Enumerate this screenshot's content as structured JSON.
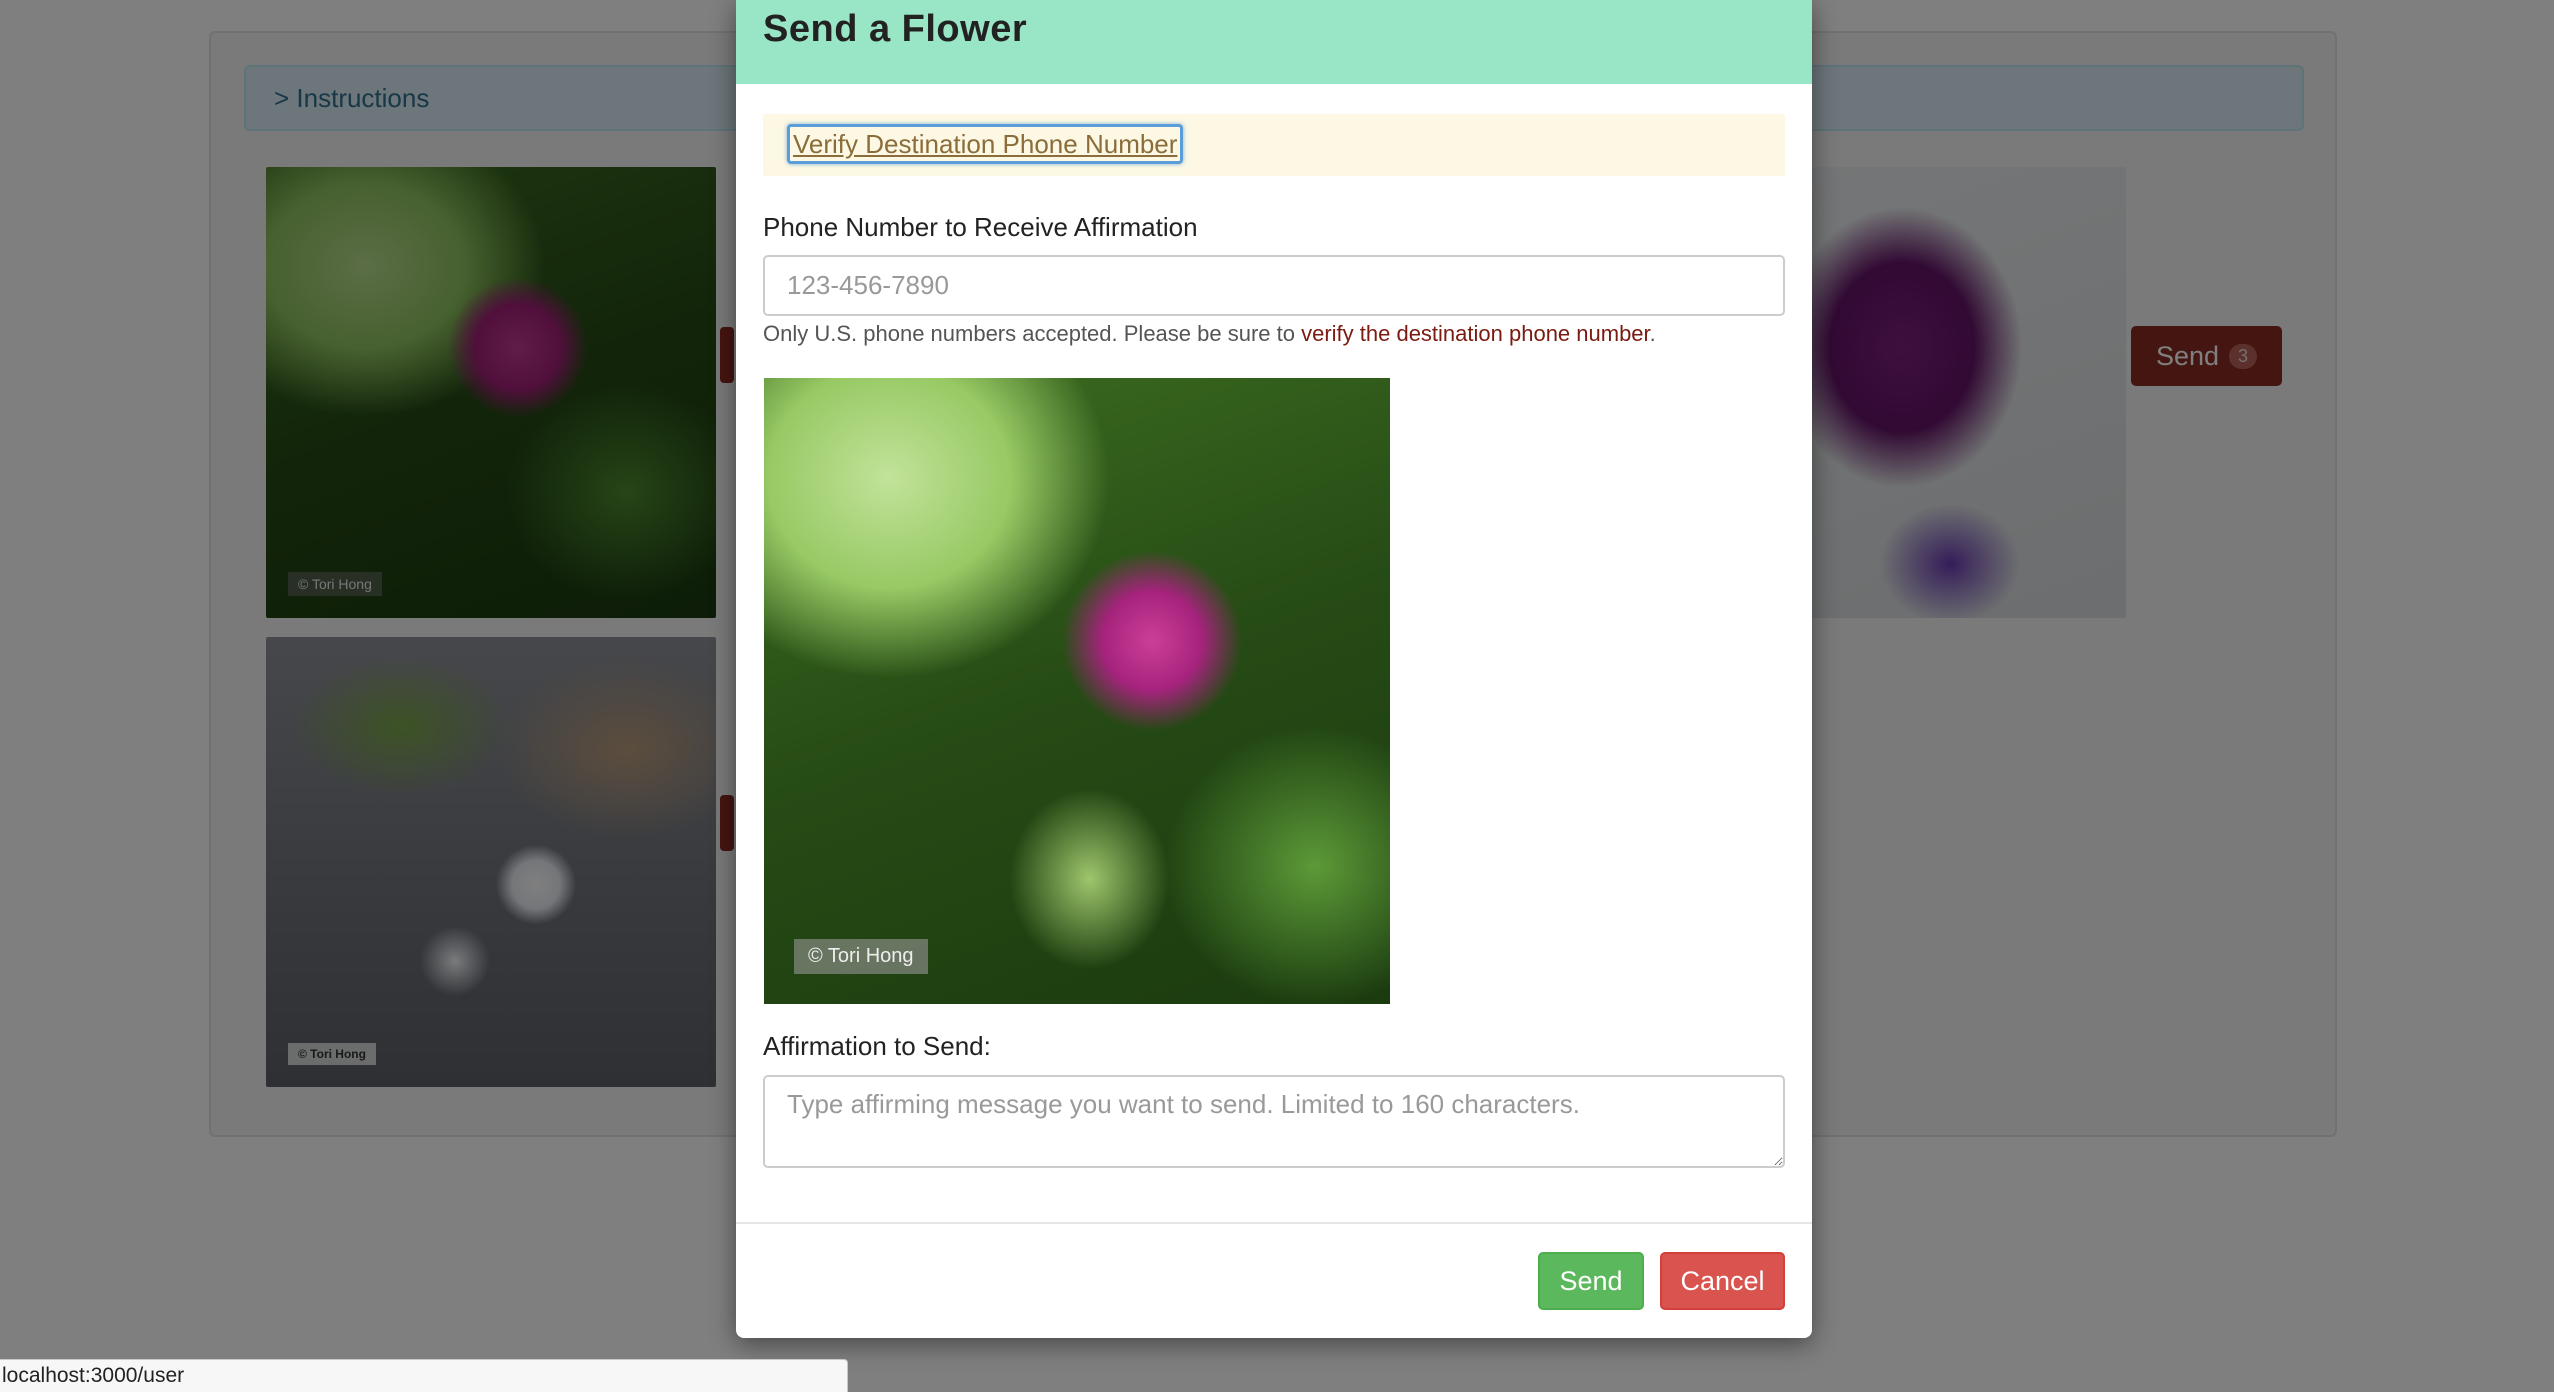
{
  "background_page": {
    "instructions_label": "> Instructions",
    "photo_watermark": "© Tori Hong",
    "send_button": {
      "label": "Send",
      "count": "3"
    }
  },
  "modal": {
    "title": "Send a Flower",
    "verify_link": "Verify Destination Phone Number",
    "phone_label": "Phone Number to Receive Affirmation",
    "phone_placeholder": "123-456-7890",
    "phone_value": "",
    "help_text_prefix": "Only U.S. phone numbers accepted. Please be sure to ",
    "help_text_link": "verify the destination phone number",
    "help_text_suffix": ".",
    "photo_watermark": "© Tori Hong",
    "affirmation_label": "Affirmation to Send:",
    "affirmation_placeholder": "Type affirming message you want to send. Limited to 160 characters.",
    "send_button": "Send",
    "cancel_button": "Cancel"
  },
  "status_bar": {
    "url": "localhost:3000/user"
  },
  "colors": {
    "header_bg": "#99e6c6",
    "alert_bg": "#fcf8e3",
    "send_green": "#5cb85c",
    "cancel_red": "#d9534f",
    "dark_red_button": "#8b2b23"
  }
}
